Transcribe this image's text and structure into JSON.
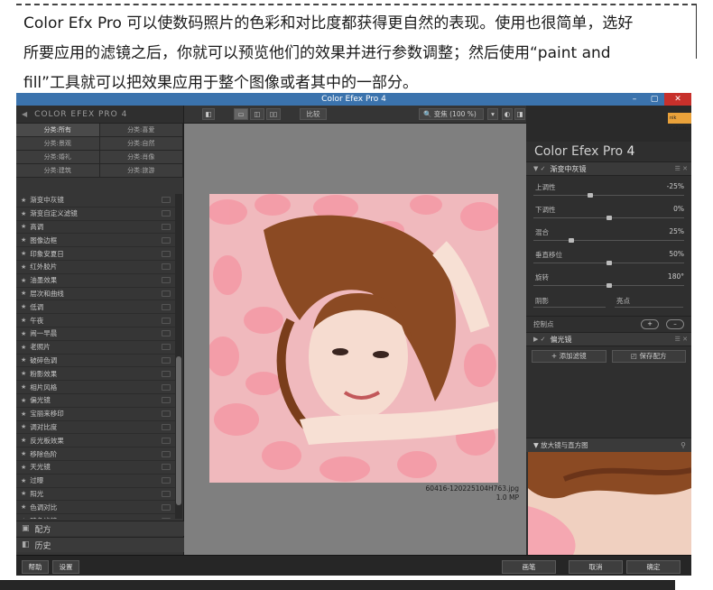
{
  "intro": {
    "line1": "Color Efx Pro 可以使数码照片的色彩和对比度都获得更自然的表现。使用也很简单，选好",
    "line2": "所要应用的滤镜之后，你就可以预览他们的效果并进行参数调整；然后使用“paint and",
    "line3": "fill”工具就可以把效果应用于整个图像或者其中的一部分。"
  },
  "window": {
    "title": "Color Efex Pro 4",
    "minimize": "–",
    "maximize": "▢",
    "close": "✕"
  },
  "left_panel": {
    "header": "COLOR EFEX PRO 4",
    "categories": [
      "分类:所有",
      "分类:喜爱",
      "分类:景观",
      "分类:自然",
      "分类:婚礼",
      "分类:肖像",
      "分类:建筑",
      "分类:旅游"
    ],
    "filters": [
      "渐变中灰镜",
      "渐变自定义滤镜",
      "高调",
      "图像边框",
      "印象安夏日",
      "红外胶片",
      "油墨效果",
      "层次和曲线",
      "低调",
      "午夜",
      "闹一早晨",
      "老照片",
      "破碎色调",
      "粉影效果",
      "相片风格",
      "偏光镜",
      "宝丽来移印",
      "调对比度",
      "反光板效果",
      "移除色阶",
      "天光镜",
      "过曝",
      "阳光",
      "色调对比",
      "暗角滤镜"
    ],
    "section_recipes": "配方",
    "section_history": "历史"
  },
  "toolbar": {
    "compare": "比较",
    "zoom": "变焦 (100 %)"
  },
  "canvas": {
    "filename": "60416-120225104H763.jpg",
    "filesize": "1.0 MP"
  },
  "right_panel": {
    "brand": "nik Collection",
    "title_prefix": "Color Efex Pro",
    "title_num": "4",
    "filter1": "渐变中灰镜",
    "params": [
      {
        "label": "上调性",
        "value": "-25%",
        "pos": 0.375
      },
      {
        "label": "下调性",
        "value": "0%",
        "pos": 0.5
      },
      {
        "label": "混合",
        "value": "25%",
        "pos": 0.25
      },
      {
        "label": "垂直移位",
        "value": "50%",
        "pos": 0.5
      },
      {
        "label": "旋转",
        "value": "180°",
        "pos": 0.5
      }
    ],
    "shadow": "阴影",
    "highlight": "亮点",
    "control_points": "控制点",
    "cp_add": "+",
    "cp_remove": "–",
    "filter2": "偏光镜",
    "add_filter": "添加滤镜",
    "save_recipe": "保存配方",
    "loupe": "放大镜与直方图"
  },
  "bottom_bar": {
    "help": "帮助",
    "settings": "设置",
    "brush": "画笔",
    "cancel": "取消",
    "ok": "确定"
  }
}
